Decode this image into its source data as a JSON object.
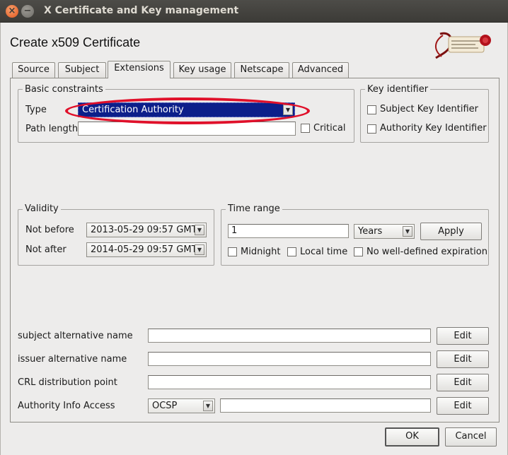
{
  "window": {
    "title": "X Certificate and Key management",
    "close_glyph": "×",
    "minimize_glyph": "−"
  },
  "dialog": {
    "heading": "Create x509 Certificate"
  },
  "logo": {
    "alt": "Certificate and Key management seal"
  },
  "tabs": [
    {
      "label": "Source",
      "active": false
    },
    {
      "label": "Subject",
      "active": false
    },
    {
      "label": "Extensions",
      "active": true
    },
    {
      "label": "Key usage",
      "active": false
    },
    {
      "label": "Netscape",
      "active": false
    },
    {
      "label": "Advanced",
      "active": false
    }
  ],
  "basic_constraints": {
    "title": "Basic constraints",
    "type_label": "Type",
    "type_value": "Certification Authority",
    "path_length_label": "Path length",
    "path_length_value": "",
    "critical_label": "Critical",
    "critical_checked": false
  },
  "key_identifier": {
    "title": "Key identifier",
    "subject_key_label": "Subject Key Identifier",
    "subject_key_checked": false,
    "authority_key_label": "Authority Key Identifier",
    "authority_key_checked": false
  },
  "validity": {
    "title": "Validity",
    "not_before_label": "Not before",
    "not_before_value": "2013-05-29 09:57 GMT",
    "not_after_label": "Not after",
    "not_after_value": "2014-05-29 09:57 GMT"
  },
  "time_range": {
    "title": "Time range",
    "amount_value": "1",
    "unit_value": "Years",
    "apply_label": "Apply",
    "midnight_label": "Midnight",
    "local_time_label": "Local time",
    "no_expiration_label": "No well-defined expiration"
  },
  "extensions": {
    "subject_alt_label": "subject alternative name",
    "issuer_alt_label": "issuer alternative name",
    "crl_label": "CRL distribution point",
    "aia_label": "Authority Info Access",
    "aia_method_value": "OCSP",
    "edit_label": "Edit"
  },
  "footer": {
    "ok_label": "OK",
    "cancel_label": "Cancel"
  },
  "colors": {
    "selected_combo": "#0c1f8a",
    "highlight": "#e0102a"
  }
}
